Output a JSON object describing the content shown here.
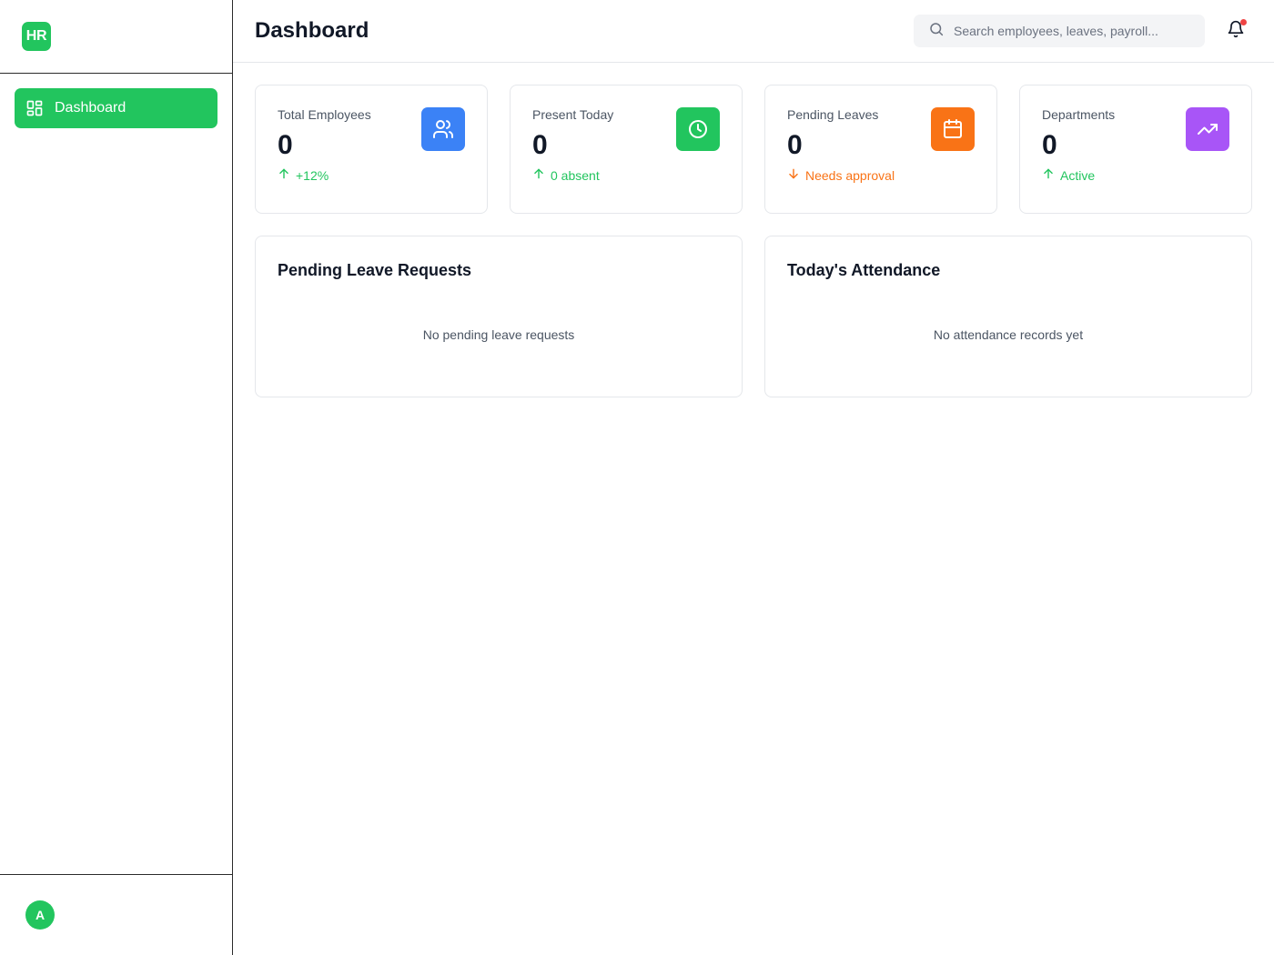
{
  "sidebar": {
    "logo": "HR",
    "nav": [
      {
        "label": "Dashboard",
        "icon": "layout-grid-icon",
        "active": true
      }
    ],
    "user_initial": "A"
  },
  "header": {
    "title": "Dashboard",
    "search_placeholder": "Search employees, leaves, payroll...",
    "notification_dot": true
  },
  "stats": [
    {
      "label": "Total Employees",
      "value": "0",
      "trend": "+12%",
      "trend_dir": "up",
      "trend_color": "#22c55e",
      "icon": "users-icon",
      "icon_bg": "#3b82f6"
    },
    {
      "label": "Present Today",
      "value": "0",
      "trend": "0 absent",
      "trend_dir": "up",
      "trend_color": "#22c55e",
      "icon": "clock-icon",
      "icon_bg": "#22c55e"
    },
    {
      "label": "Pending Leaves",
      "value": "0",
      "trend": "Needs approval",
      "trend_dir": "down",
      "trend_color": "#f97316",
      "icon": "calendar-icon",
      "icon_bg": "#f97316"
    },
    {
      "label": "Departments",
      "value": "0",
      "trend": "Active",
      "trend_dir": "up",
      "trend_color": "#22c55e",
      "icon": "trending-up-icon",
      "icon_bg": "#a855f7"
    }
  ],
  "panels": {
    "leave": {
      "title": "Pending Leave Requests",
      "empty": "No pending leave requests"
    },
    "attendance": {
      "title": "Today's Attendance",
      "empty": "No attendance records yet"
    }
  },
  "colors": {
    "accent": "#22c55e",
    "border": "#e5e7eb"
  }
}
